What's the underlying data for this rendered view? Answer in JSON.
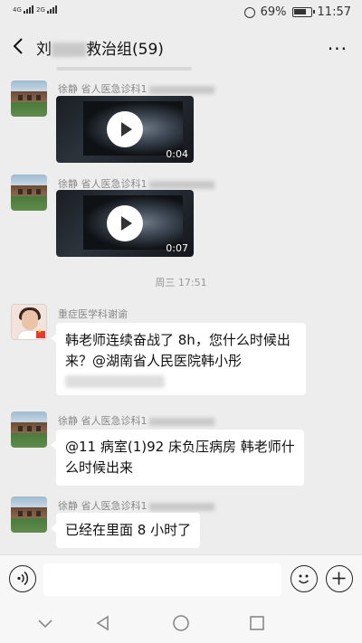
{
  "status": {
    "signal1": "4G",
    "signal2": "2G",
    "battery": "69%",
    "time": "11:57"
  },
  "header": {
    "title_prefix": "刘",
    "title_suffix": "救治组(59)",
    "more_label": "···"
  },
  "messages": [
    {
      "sender": "徐静 省人医急诊科1",
      "video_duration": "0:04"
    },
    {
      "sender": "徐静 省人医急诊科1",
      "video_duration": "0:07"
    },
    {
      "sender": "重症医学科谢谕",
      "text": "韩老师连续奋战了 8h，您什么时候出来？@湖南省人民医院韩小彤"
    },
    {
      "sender": "徐静 省人医急诊科1",
      "text": "@11 病室(1)92 床负压病房  韩老师什么时候出来"
    },
    {
      "sender": "徐静 省人医急诊科1",
      "text": "已经在里面 8 小时了"
    }
  ],
  "time_separator": "周三 17:51",
  "input": {
    "placeholder": ""
  },
  "icons": {
    "back": "back-arrow-icon",
    "more": "more-icon",
    "voice": "voice-icon",
    "emoji": "emoji-icon",
    "plus": "plus-icon",
    "play": "play-icon"
  }
}
